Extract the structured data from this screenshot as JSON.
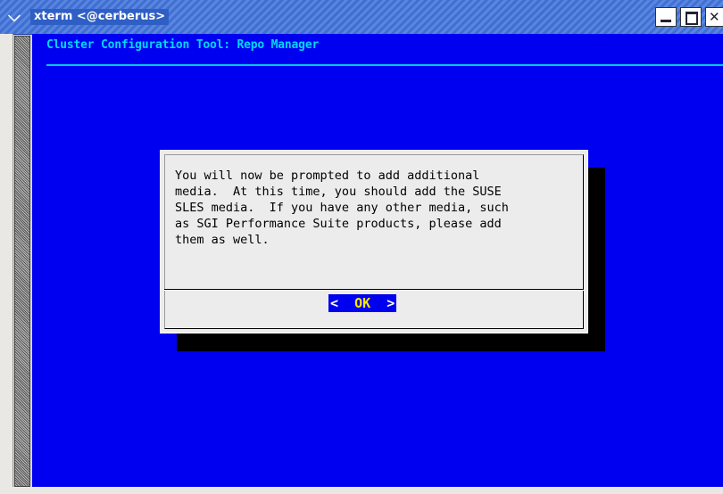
{
  "window": {
    "title": "xterm <@cerberus>",
    "menu_icon": "chevron-down-icon",
    "controls": [
      "minimize-icon",
      "maximize-icon",
      "close-icon"
    ]
  },
  "terminal": {
    "app_title": "Cluster Configuration Tool: Repo Manager",
    "dialog": {
      "message": "You will now be prompted to add additional\nmedia.  At this time, you should add the SUSE\nSLES media.  If you have any other media, such\nas SGI Performance Suite products, please add\nthem as well.",
      "ok_left": "<  ",
      "ok_hotkey": "O",
      "ok_rest": "K",
      "ok_right": "  >"
    }
  },
  "colors": {
    "terminal_bg": "#0000f0",
    "title_fg": "#00d8ff",
    "dialog_bg": "#ececec",
    "hotkey": "#ffe600"
  }
}
